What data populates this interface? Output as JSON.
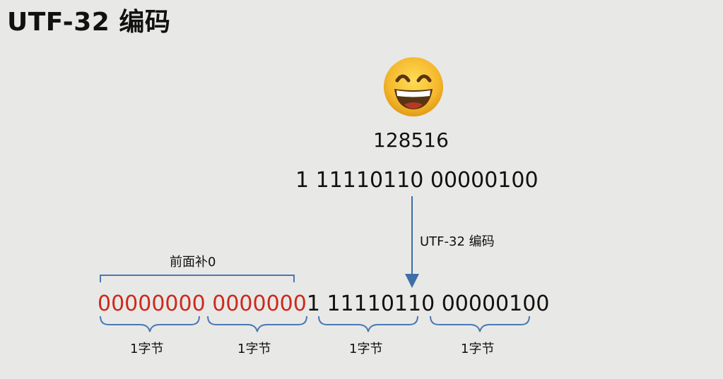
{
  "header": {
    "title": "UTF-32 编码"
  },
  "example": {
    "emoji_icon": "grinning-face-with-smiling-eyes-icon",
    "code_point": "128516",
    "binary_original": "1 11110110 00000100"
  },
  "encoding": {
    "arrow_label": "UTF-32 编码",
    "padding_label": "前面补0",
    "padded_zeros_part1": "00000000",
    "padded_zeros_part2": "0000000",
    "binary_rest": "1 11110110 00000100",
    "byte_label": "1字节",
    "byte_labels": [
      "1字节",
      "1字节",
      "1字节",
      "1字节"
    ]
  },
  "colors": {
    "padding_red": "#cc2a1e",
    "arrow_blue": "#3f6fa8",
    "bracket_blue": "#4a78b5",
    "background": "#e8e8e6"
  }
}
